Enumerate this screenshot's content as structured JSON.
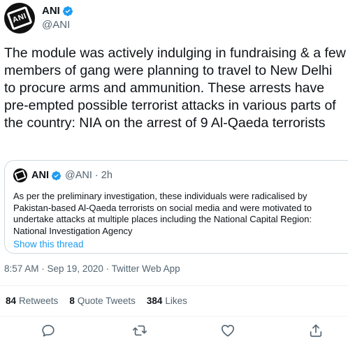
{
  "tweet": {
    "author": {
      "display_name": "ANI",
      "handle": "@ANI",
      "avatar_text": "ANI"
    },
    "text": "The module was actively indulging in fundraising & a few members of gang were planning to travel to New Delhi to procure arms and ammunition. These arrests have pre-empted possible terrorist attacks in various parts of the country: NIA on the arrest of 9 Al-Qaeda terrorists",
    "quoted": {
      "display_name": "ANI",
      "meta": "@ANI · 2h",
      "text": "As per the preliminary investigation, these individuals were radicalised by Pakistan-based Al-Qaeda terrorists on social media and were motivated to undertake attacks at multiple places including the National Capital Region: National Investigation Agency",
      "show_thread": "Show this thread"
    },
    "timestamp": "8:57 AM · Sep 19, 2020 · Twitter Web App",
    "stats": {
      "retweets_count": "84",
      "retweets_label": "Retweets",
      "quotes_count": "8",
      "quotes_label": "Quote Tweets",
      "likes_count": "384",
      "likes_label": "Likes"
    }
  },
  "colors": {
    "text": "#0f1419",
    "secondary": "#536471",
    "accent": "#1d9bf0",
    "border": "#cfd9de"
  },
  "icons": {
    "verified": "verified-badge-icon",
    "reply": "reply-icon",
    "retweet": "retweet-icon",
    "like": "heart-icon",
    "share": "share-icon"
  }
}
